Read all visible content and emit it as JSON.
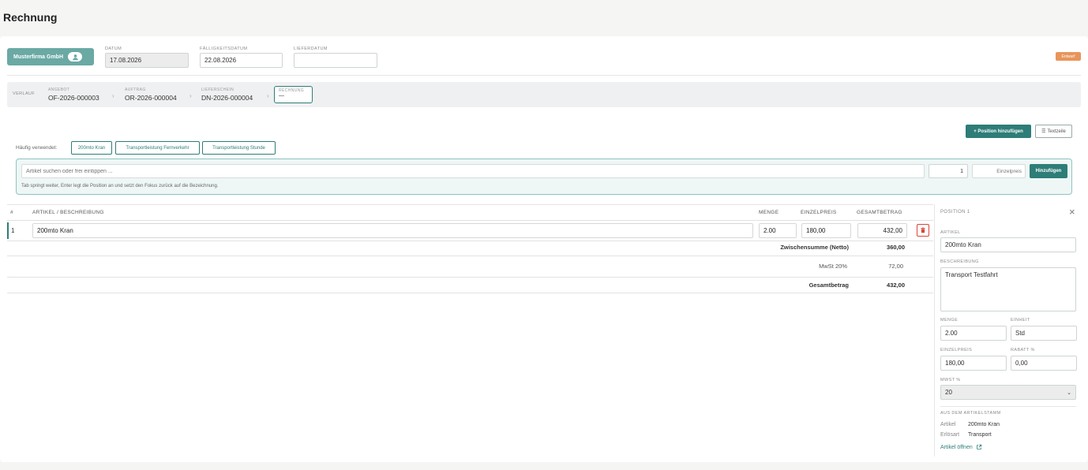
{
  "page": {
    "title": "Rechnung"
  },
  "header": {
    "customer": "Musterfirma GmbH",
    "status": "Entwurf",
    "datum_label": "DATUM",
    "datum_value": "17.08.2026",
    "faellig_label": "FÄLLIGKEITSDATUM",
    "faellig_value": "22.08.2026",
    "liefer_label": "LIEFERDATUM",
    "liefer_value": ""
  },
  "history": {
    "label": "VERLAUF",
    "steps": [
      {
        "label": "ANGEBOT",
        "value": "OF-2026-000003"
      },
      {
        "label": "AUFTRAG",
        "value": "OR-2026-000004"
      },
      {
        "label": "LIEFERSCHEIN",
        "value": "DN-2026-000004"
      },
      {
        "label": "RECHNUNG",
        "value": "—"
      }
    ]
  },
  "toolbar": {
    "add_position": "+ Position hinzufügen",
    "text_line": "Textzeile"
  },
  "frequent": {
    "label": "Häufig verwendet:",
    "chips": [
      "200mto Kran",
      "Transportleistung Fernverkehr",
      "Transportleistung Stunde"
    ]
  },
  "quick_add": {
    "search_placeholder": "Artikel suchen oder frei eintippen ...",
    "qty": "1",
    "price_placeholder": "Einzelpreis",
    "add_button": "Hinzufügen",
    "hint": "Tab springt weiter, Enter legt die Position an und setzt den Fokus zurück auf die Bezeichnung."
  },
  "table": {
    "headers": {
      "num": "#",
      "article": "ARTIKEL / BESCHREIBUNG",
      "qty": "MENGE",
      "price": "EINZELPREIS",
      "total": "GESAMTBETRAG"
    },
    "rows": [
      {
        "num": "1",
        "article": "200mto Kran",
        "qty": "2.00",
        "price": "180,00",
        "total": "432,00"
      }
    ],
    "totals": {
      "subtotal_label": "Zwischensumme (Netto)",
      "subtotal_value": "360,00",
      "vat_label": "MwSt 20%",
      "vat_value": "72,00",
      "grand_label": "Gesamtbetrag",
      "grand_value": "432,00"
    }
  },
  "detail": {
    "title": "POSITION 1",
    "artikel_label": "ARTIKEL",
    "artikel_value": "200mto Kran",
    "beschreibung_label": "BESCHREIBUNG",
    "beschreibung_value": "Transport Testfahrt",
    "menge_label": "MENGE",
    "menge_value": "2.00",
    "einheit_label": "EINHEIT",
    "einheit_value": "Std",
    "einzelpreis_label": "EINZELPREIS",
    "einzelpreis_value": "180,00",
    "rabatt_label": "RABATT %",
    "rabatt_value": "0,00",
    "mwst_label": "MWST %",
    "mwst_value": "20",
    "stamm_label": "AUS DEM ARTIKELSTAMM",
    "stamm_artikel_key": "Artikel",
    "stamm_artikel_val": "200mto Kran",
    "stamm_erloes_key": "Erlösart",
    "stamm_erloes_val": "Transport",
    "open_link": "Artikel öffnen"
  },
  "colors": {
    "accent": "#2e7d78",
    "customer": "#6aa9a4",
    "status": "#e8955b",
    "delete": "#d9453a"
  }
}
